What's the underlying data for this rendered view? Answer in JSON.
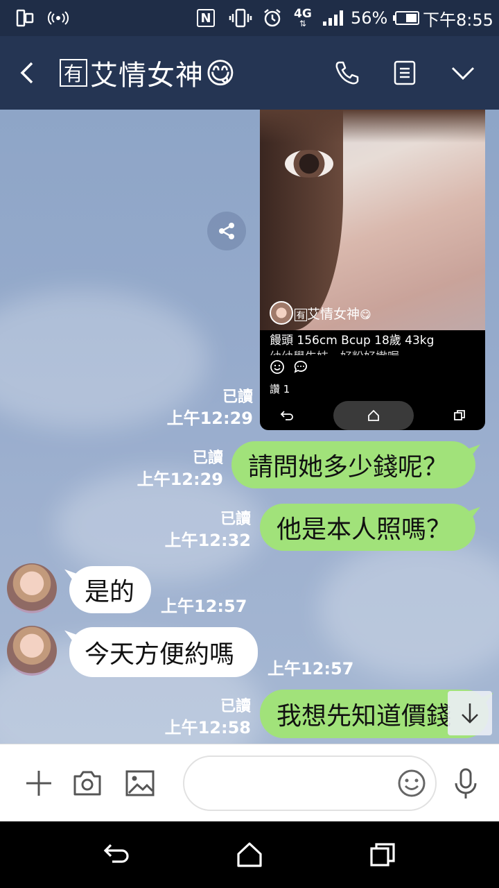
{
  "status_bar": {
    "battery_percent": "56%",
    "time": "下午8:55",
    "network": "4G",
    "nfc": "N"
  },
  "header": {
    "title_badge": "有",
    "title": "艾情女神",
    "emoji": "😋"
  },
  "messages": {
    "image": {
      "read": "已讀",
      "time": "上午12:29",
      "embedded_name_badge": "有",
      "embedded_name": "艾情女神",
      "embedded_caption": "饅頭 156cm Bcup 18歲 43kg",
      "embedded_caption_2": "幼幼學生妹，好粉好嫩喔",
      "embedded_likes": "讚 1"
    },
    "m1": {
      "text": "請問她多少錢呢？",
      "read": "已讀",
      "time": "上午12:29"
    },
    "m2": {
      "text": "他是本人照嗎？",
      "read": "已讀",
      "time": "上午12:32"
    },
    "m3": {
      "text": "是的",
      "time": "上午12:57"
    },
    "m4": {
      "text": "今天方便約嗎",
      "time": "上午12:57"
    },
    "m5": {
      "text": "我想先知道價錢",
      "read": "已讀",
      "time": "上午12:58"
    }
  },
  "input": {
    "placeholder": ""
  }
}
